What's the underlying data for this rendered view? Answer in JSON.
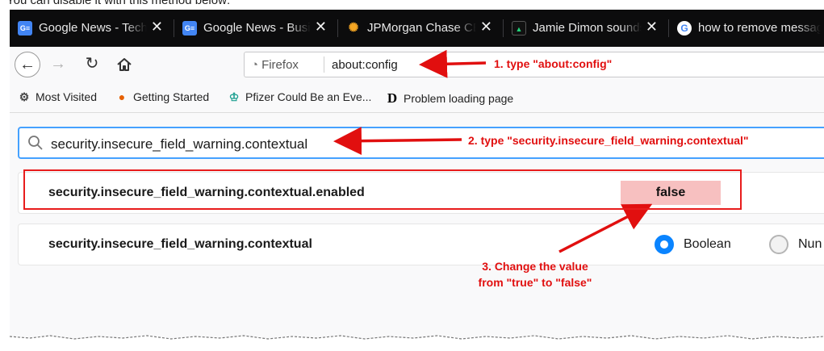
{
  "caption": "You can disable it with this method below:",
  "tabs": [
    {
      "title": "Google News - Tech",
      "favicon": "google-news-icon",
      "favicon_text": "G≡",
      "favicon_color": "#4285f4"
    },
    {
      "title": "Google News - Business",
      "favicon": "google-news-icon",
      "favicon_text": "G≡",
      "favicon_color": "#4285f4"
    },
    {
      "title": "JPMorgan Chase CEO",
      "favicon": "nbc-peacock-icon",
      "favicon_text": "✺",
      "favicon_color": "#e8e8e8"
    },
    {
      "title": "Jamie Dimon sounds",
      "favicon": "thestreet-icon",
      "favicon_text": "▲",
      "favicon_color": "#111111"
    },
    {
      "title": "how to remove message",
      "favicon": "google-g-icon",
      "favicon_text": "G",
      "favicon_color": "#ffffff"
    }
  ],
  "nav": {
    "identity": "Firefox",
    "url": "about:config"
  },
  "bookmarks": [
    {
      "label": "Most Visited",
      "icon": "gear-icon",
      "glyph": "⚙"
    },
    {
      "label": "Getting Started",
      "icon": "firefox-icon",
      "glyph": "●"
    },
    {
      "label": "Pfizer Could Be an Eve...",
      "icon": "motley-fool-icon",
      "glyph": "♔"
    },
    {
      "label": "Problem loading page",
      "icon": "d-logo-icon",
      "glyph": "D"
    }
  ],
  "config": {
    "search_value": "security.insecure_field_warning.contextual",
    "prefs": [
      {
        "name": "security.insecure_field_warning.contextual.enabled",
        "value": "false"
      },
      {
        "name": "security.insecure_field_warning.contextual",
        "type_options": [
          "Boolean",
          "Nun"
        ]
      }
    ]
  },
  "annotations": {
    "step1": "1. type \"about:config\"",
    "step2": "2. type \"security.insecure_field_warning.contextual\"",
    "step3_line1": "3. Change the value",
    "step3_line2": "from \"true\" to \"false\""
  },
  "colors": {
    "annotation_red": "#e10f0f",
    "focus_blue": "#45a1ff",
    "value_highlight": "#f7c0c0",
    "tab_bar": "#0c0c0d"
  }
}
